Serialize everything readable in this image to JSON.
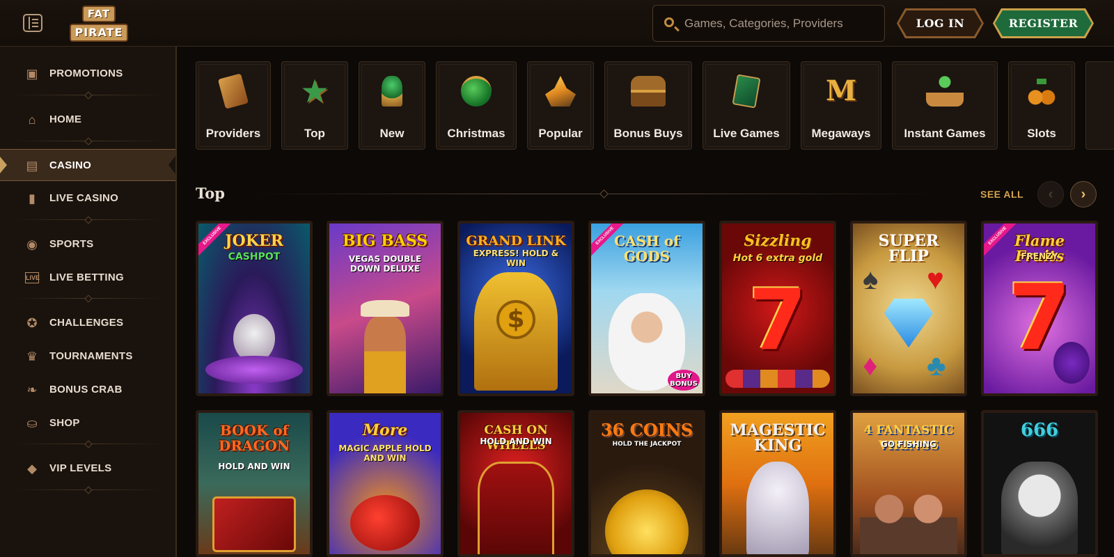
{
  "header": {
    "logo_line1": "FAT",
    "logo_line2": "PIRATE",
    "search_placeholder": "Games, Categories, Providers",
    "login_label": "LOG IN",
    "register_label": "REGISTER"
  },
  "sidebar": {
    "items": [
      {
        "label": "PROMOTIONS",
        "icon": "gift-chest-icon"
      },
      {
        "label": "HOME",
        "icon": "home-icon"
      },
      {
        "label": "CASINO",
        "icon": "slot-machine-icon",
        "active": true
      },
      {
        "label": "LIVE CASINO",
        "icon": "card-icon"
      },
      {
        "label": "SPORTS",
        "icon": "ball-icon"
      },
      {
        "label": "LIVE BETTING",
        "icon": "live-icon"
      },
      {
        "label": "CHALLENGES",
        "icon": "medal-icon"
      },
      {
        "label": "TOURNAMENTS",
        "icon": "trophy-icon"
      },
      {
        "label": "BONUS CRAB",
        "icon": "crab-icon"
      },
      {
        "label": "SHOP",
        "icon": "bag-icon"
      },
      {
        "label": "VIP LEVELS",
        "icon": "diamond-icon"
      }
    ]
  },
  "categories": [
    {
      "label": "Providers",
      "icon": "scroll-icon"
    },
    {
      "label": "Top",
      "icon": "star-icon"
    },
    {
      "label": "New",
      "icon": "goblet-icon"
    },
    {
      "label": "Christmas",
      "icon": "ornament-icon"
    },
    {
      "label": "Popular",
      "icon": "crystal-icon"
    },
    {
      "label": "Bonus Buys",
      "icon": "chest-icon"
    },
    {
      "label": "Live Games",
      "icon": "cards-icon"
    },
    {
      "label": "Megaways",
      "icon": "m-icon"
    },
    {
      "label": "Instant Games",
      "icon": "joystick-icon"
    },
    {
      "label": "Slots",
      "icon": "cherries-icon"
    }
  ],
  "section": {
    "title": "Top",
    "see_all": "SEE ALL"
  },
  "games_row1": [
    {
      "title": "JOKER",
      "subtitle": "CASHPOT",
      "badge": "EXCLUSIVE"
    },
    {
      "title": "BIG BASS",
      "subtitle": "VEGAS DOUBLE DOWN DELUXE"
    },
    {
      "title": "GRAND LINK",
      "subtitle": "EXPRESS! HOLD & WIN"
    },
    {
      "title": "CASH of GODS",
      "subtitle": "BUY BONUS",
      "badge": "EXCLUSIVE"
    },
    {
      "title": "Sizzling",
      "subtitle": "Hot 6 extra gold"
    },
    {
      "title": "SUPER FLIP",
      "subtitle": ""
    },
    {
      "title": "Flame Fruits",
      "subtitle": "FRENZY",
      "badge": "EXCLUSIVE"
    }
  ],
  "games_row2": [
    {
      "title": "BOOK of DRAGON",
      "subtitle": "HOLD AND WIN"
    },
    {
      "title": "More",
      "subtitle": "MAGIC APPLE HOLD AND WIN"
    },
    {
      "title": "CASH ON WHEELS",
      "subtitle": "HOLD AND WIN"
    },
    {
      "title": "36 COINS",
      "subtitle": "HOLD THE JACKPOT"
    },
    {
      "title": "MAGESTIC KING",
      "subtitle": ""
    },
    {
      "title": "4 FANTASTIC VIKINGS",
      "subtitle": "GO FISHING"
    },
    {
      "title": "666",
      "subtitle": ""
    }
  ],
  "colors": {
    "accent_gold": "#d8a34e",
    "register_green": "#1e6a3a",
    "bg": "#0c0907"
  }
}
